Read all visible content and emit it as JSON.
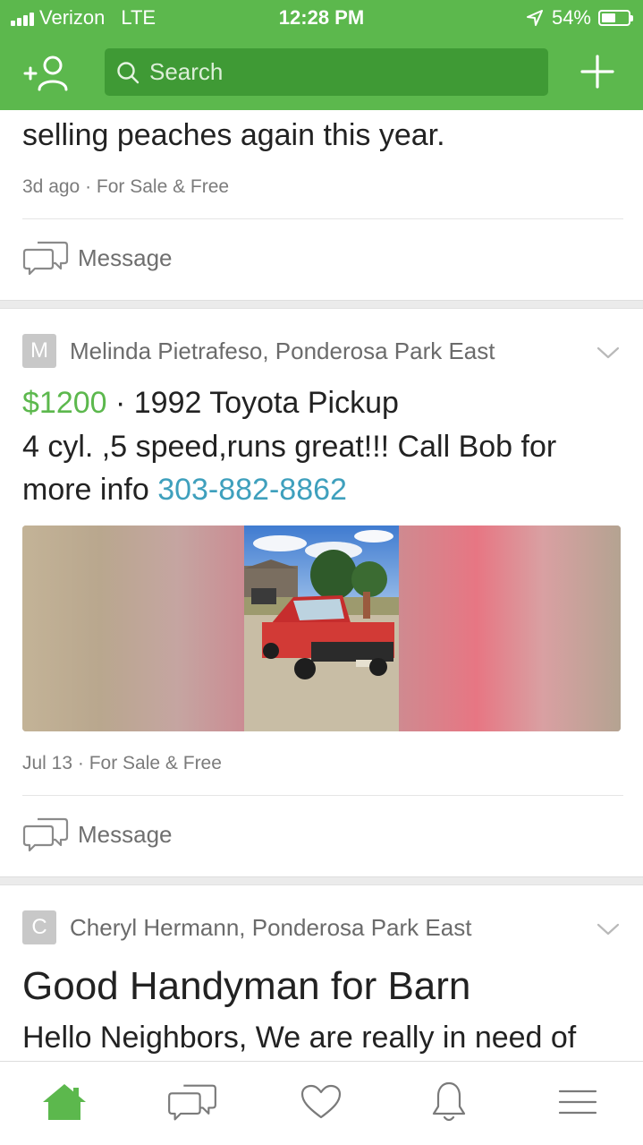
{
  "status_bar": {
    "carrier": "Verizon",
    "network": "LTE",
    "time": "12:28 PM",
    "battery_text": "54%",
    "battery_level": 0.54
  },
  "header": {
    "search_placeholder": "Search",
    "icons": [
      "add-neighbor-icon",
      "search-icon",
      "plus-icon"
    ],
    "color": "#5cb84d"
  },
  "posts": [
    {
      "body_text": "selling peaches again this year.",
      "meta": "3d ago · For Sale & Free",
      "message_label": "Message"
    },
    {
      "avatar_letter": "M",
      "author": "Melinda Pietrafeso, Ponderosa Park East",
      "price": "$1200",
      "title_separator": " · ",
      "title": "1992 Toyota Pickup",
      "body_line1": "4 cyl. ,5 speed,runs great!!! Call  Bob for",
      "body_line2_prefix": "more info ",
      "phone": "303-882-8862",
      "meta": "Jul 13 · For Sale & Free",
      "message_label": "Message"
    },
    {
      "avatar_letter": "C",
      "author": "Cheryl Hermann, Ponderosa Park East",
      "title": "Good Handyman for Barn",
      "body_text": "Hello Neighbors, We are really in need of"
    }
  ],
  "tabbar": {
    "tabs": [
      "home-icon",
      "messages-icon",
      "heart-icon",
      "bell-icon",
      "menu-icon"
    ],
    "active_color": "#5cb84d"
  }
}
